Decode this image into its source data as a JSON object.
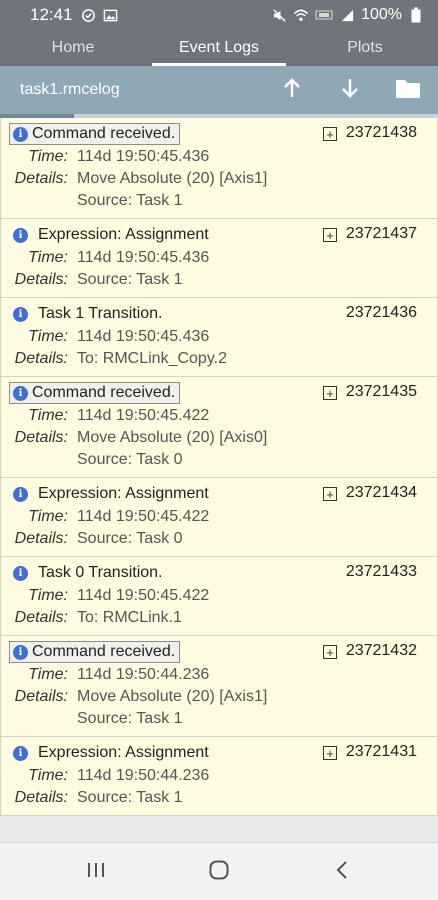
{
  "status": {
    "time": "12:41",
    "battery": "100%",
    "left_icons": [
      "sync-icon",
      "image-icon"
    ],
    "right_icons": [
      "mute-icon",
      "wifi-icon",
      "volte-icon",
      "signal-icon",
      "battery-icon"
    ]
  },
  "tabs": [
    {
      "label": "Home",
      "active": false
    },
    {
      "label": "Event Logs",
      "active": true
    },
    {
      "label": "Plots",
      "active": false
    }
  ],
  "toolbar": {
    "file_name": "task1.rmcelog",
    "buttons": [
      "arrow-up-icon",
      "arrow-down-icon",
      "folder-icon"
    ],
    "progress_fraction": 0.17
  },
  "labels": {
    "time": "Time:",
    "details": "Details:"
  },
  "entries": [
    {
      "title": "Command received.",
      "boxed": true,
      "expandable": true,
      "id": "23721438",
      "time": "114d 19:50:45.436",
      "details": [
        "Move Absolute (20) [Axis1]",
        "Source: Task 1"
      ]
    },
    {
      "title": "Expression: Assignment",
      "boxed": false,
      "expandable": true,
      "id": "23721437",
      "time": "114d 19:50:45.436",
      "details": [
        "Source: Task 1"
      ]
    },
    {
      "title": "Task 1 Transition.",
      "boxed": false,
      "expandable": false,
      "id": "23721436",
      "time": "114d 19:50:45.436",
      "details": [
        "To: RMCLink_Copy.2"
      ]
    },
    {
      "title": "Command received.",
      "boxed": true,
      "expandable": true,
      "id": "23721435",
      "time": "114d 19:50:45.422",
      "details": [
        "Move Absolute (20) [Axis0]",
        "Source: Task 0"
      ]
    },
    {
      "title": "Expression: Assignment",
      "boxed": false,
      "expandable": true,
      "id": "23721434",
      "time": "114d 19:50:45.422",
      "details": [
        "Source: Task 0"
      ]
    },
    {
      "title": "Task 0 Transition.",
      "boxed": false,
      "expandable": false,
      "id": "23721433",
      "time": "114d 19:50:45.422",
      "details": [
        "To: RMCLink.1"
      ]
    },
    {
      "title": "Command received.",
      "boxed": true,
      "expandable": true,
      "id": "23721432",
      "time": "114d 19:50:44.236",
      "details": [
        "Move Absolute (20) [Axis1]",
        "Source: Task 1"
      ]
    },
    {
      "title": "Expression: Assignment",
      "boxed": false,
      "expandable": true,
      "id": "23721431",
      "time": "114d 19:50:44.236",
      "details": [
        "Source: Task 1"
      ]
    }
  ],
  "nav": [
    "recent-apps-icon",
    "home-icon",
    "back-icon"
  ],
  "colors": {
    "header": "#6f757b",
    "toolbar": "#90a7b4",
    "entry_bg": "#fffbe1",
    "info_icon": "#3e6fd1"
  }
}
